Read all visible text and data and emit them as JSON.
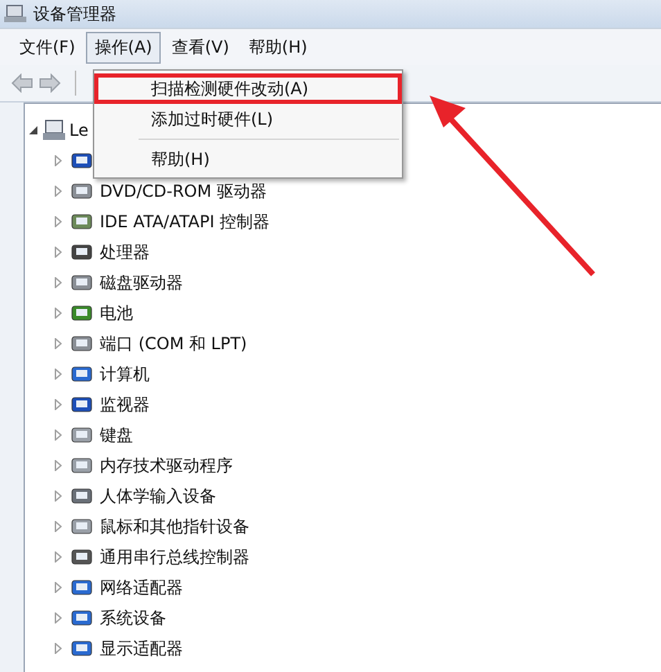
{
  "window": {
    "title": "设备管理器"
  },
  "menu_bar": [
    {
      "label": "文件(F)",
      "selected": false
    },
    {
      "label": "操作(A)",
      "selected": true
    },
    {
      "label": "查看(V)",
      "selected": false
    },
    {
      "label": "帮助(H)",
      "selected": false
    }
  ],
  "dropdown": {
    "items": [
      {
        "kind": "item",
        "label": "扫描检测硬件改动(A)",
        "highlighted": true
      },
      {
        "kind": "item",
        "label": "添加过时硬件(L)",
        "highlighted": false
      },
      {
        "kind": "separator"
      },
      {
        "kind": "item",
        "label": "帮助(H)",
        "highlighted": false
      }
    ]
  },
  "tree": {
    "root": {
      "label": "Le",
      "expanded": true,
      "children": [
        {
          "expanded": false
        },
        {
          "label": "DVD/CD-ROM 驱动器",
          "expanded": false
        },
        {
          "label": "IDE ATA/ATAPI 控制器",
          "expanded": false
        },
        {
          "label": "处理器",
          "expanded": false
        },
        {
          "label": "磁盘驱动器",
          "expanded": false
        },
        {
          "label": "电池",
          "expanded": false
        },
        {
          "label": "端口 (COM 和 LPT)",
          "expanded": false
        },
        {
          "label": "计算机",
          "expanded": false
        },
        {
          "label": "监视器",
          "expanded": false
        },
        {
          "label": "键盘",
          "expanded": false
        },
        {
          "label": "内存技术驱动程序",
          "expanded": false
        },
        {
          "label": "人体学输入设备",
          "expanded": false
        },
        {
          "label": "鼠标和其他指针设备",
          "expanded": false
        },
        {
          "label": "通用串行总线控制器",
          "expanded": false
        },
        {
          "label": "网络适配器",
          "expanded": false
        },
        {
          "label": "系统设备",
          "expanded": false
        },
        {
          "label": "显示适配器",
          "expanded": false
        }
      ]
    }
  }
}
